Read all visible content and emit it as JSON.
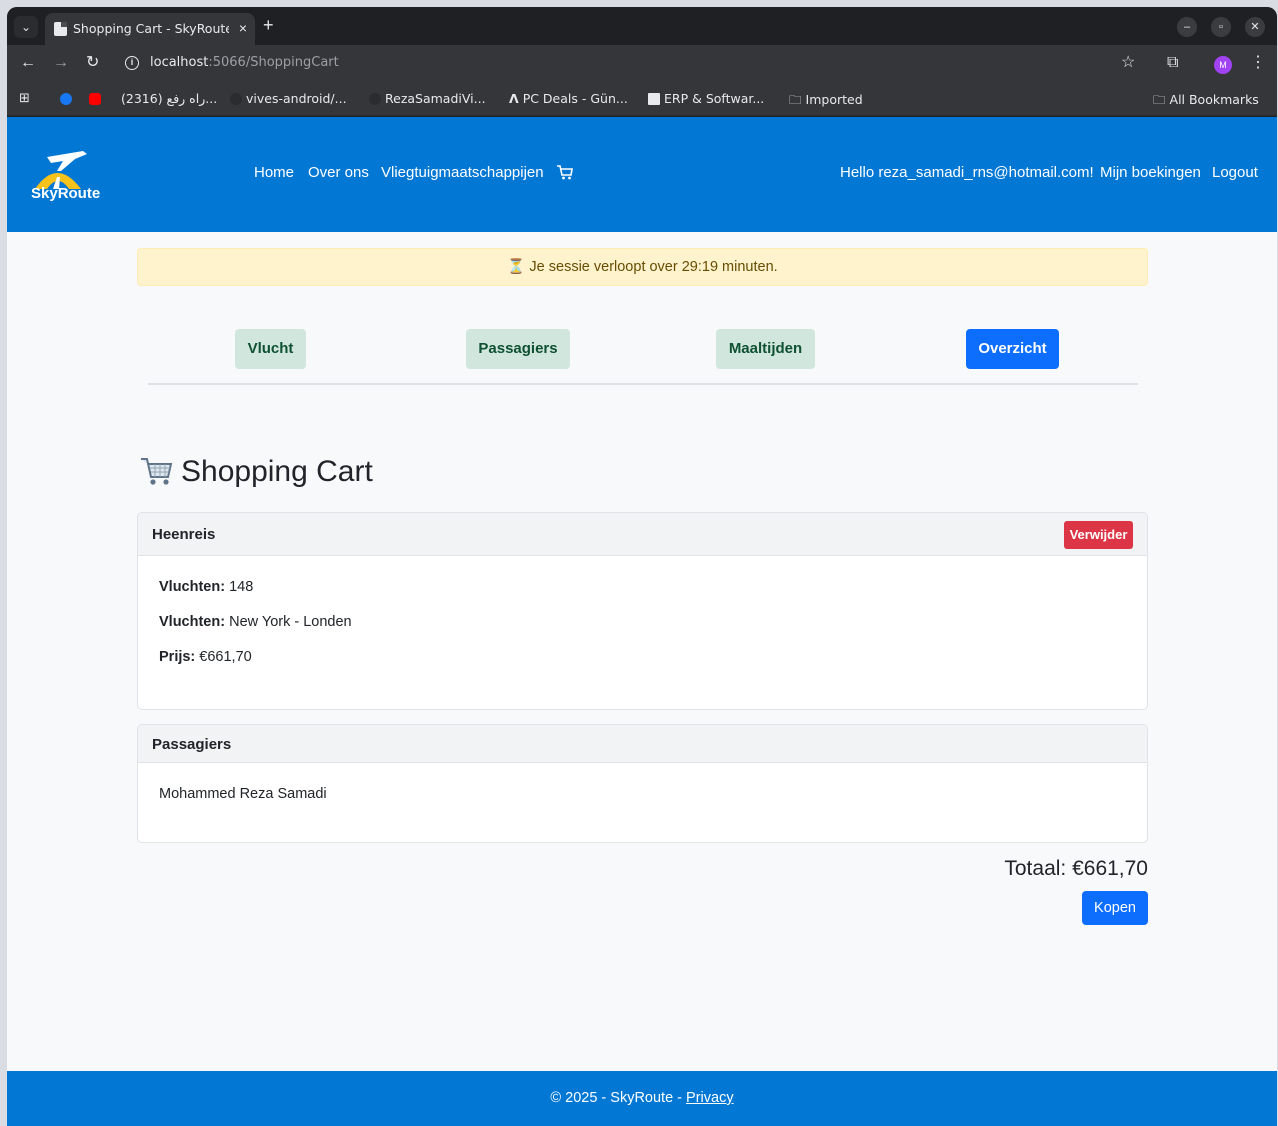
{
  "browser": {
    "tab_title": "Shopping Cart - SkyRoute",
    "url_host": "localhost",
    "url_path": ":5066/ShoppingCart",
    "profile_initial": "M",
    "bookmarks": [
      "(2316) راه رفع...",
      "vives-android/...",
      "RezaSamadiVi...",
      "PC Deals - Gün...",
      "ERP & Softwar...",
      "Imported"
    ],
    "all_bookmarks": "All Bookmarks"
  },
  "navbar": {
    "brand": "SkyRoute",
    "links": [
      "Home",
      "Over ons",
      "Vliegtuigmaatschappijen"
    ],
    "greeting": "Hello reza_samadi_rns@hotmail.com!",
    "bookings": "Mijn boekingen",
    "logout": "Logout"
  },
  "session_alert": "⏳ Je sessie verloopt over 29:19 minuten.",
  "steps": [
    "Vlucht",
    "Passagiers",
    "Maaltijden",
    "Overzicht"
  ],
  "page_title": "Shopping Cart",
  "outbound": {
    "header": "Heenreis",
    "remove_label": "Verwijder",
    "flight_label": "Vluchten:",
    "flight_number": " 148",
    "route_label": "Vluchten:",
    "route": " New York - Londen",
    "price_label": "Prijs:",
    "price": " €661,70"
  },
  "passengers": {
    "header": "Passagiers",
    "names": [
      "Mohammed Reza Samadi"
    ]
  },
  "total": "Totaal: €661,70",
  "buy_label": "Kopen",
  "footer": {
    "text": "© 2025 - SkyRoute - ",
    "privacy": "Privacy"
  },
  "colors": {
    "brand_blue": "#0277d3",
    "primary": "#0d6efd",
    "danger": "#dc3545",
    "step_done_bg": "#d1e7dd",
    "alert_bg": "#fff3cd"
  }
}
